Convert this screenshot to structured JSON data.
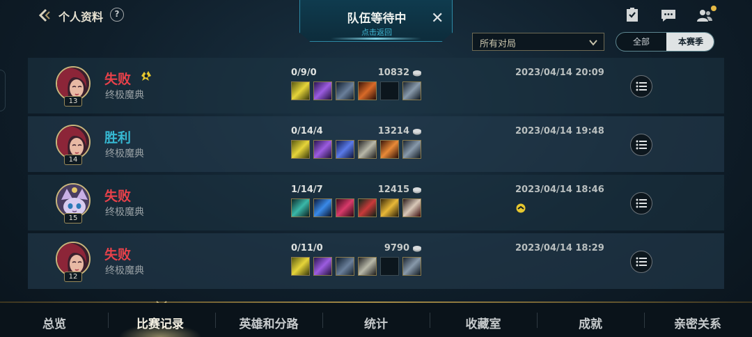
{
  "header": {
    "title": "个人资料",
    "help": "?"
  },
  "queue": {
    "title": "队伍等待中",
    "subtitle": "点击返回",
    "close": "✕"
  },
  "filters": {
    "match_type": "所有对局",
    "segments": [
      "全部",
      "本赛季"
    ],
    "selected_segment": "本赛季"
  },
  "matches": [
    {
      "result": "失败",
      "mode": "终极魔典",
      "level": "13",
      "kda": "0/9/0",
      "gold": "10832",
      "date": "2023/04/14 20:09",
      "mvp": true,
      "honor": false
    },
    {
      "result": "胜利",
      "mode": "终极魔典",
      "level": "14",
      "kda": "0/14/4",
      "gold": "13214",
      "date": "2023/04/14 19:48",
      "mvp": false,
      "honor": false
    },
    {
      "result": "失败",
      "mode": "终极魔典",
      "level": "15",
      "kda": "1/14/7",
      "gold": "12415",
      "date": "2023/04/14 18:46",
      "mvp": false,
      "honor": true
    },
    {
      "result": "失败",
      "mode": "终极魔典",
      "level": "12",
      "kda": "0/11/0",
      "gold": "9790",
      "date": "2023/04/14 18:29",
      "mvp": false,
      "honor": false
    }
  ],
  "nav": {
    "tabs": [
      "总览",
      "比赛记录",
      "英雄和分路",
      "统计",
      "收藏室",
      "成就",
      "亲密关系"
    ],
    "active": "比赛记录"
  },
  "colors": {
    "loss": "#e8414a",
    "win": "#36b8d2",
    "gold_accent": "#c9b67c"
  }
}
